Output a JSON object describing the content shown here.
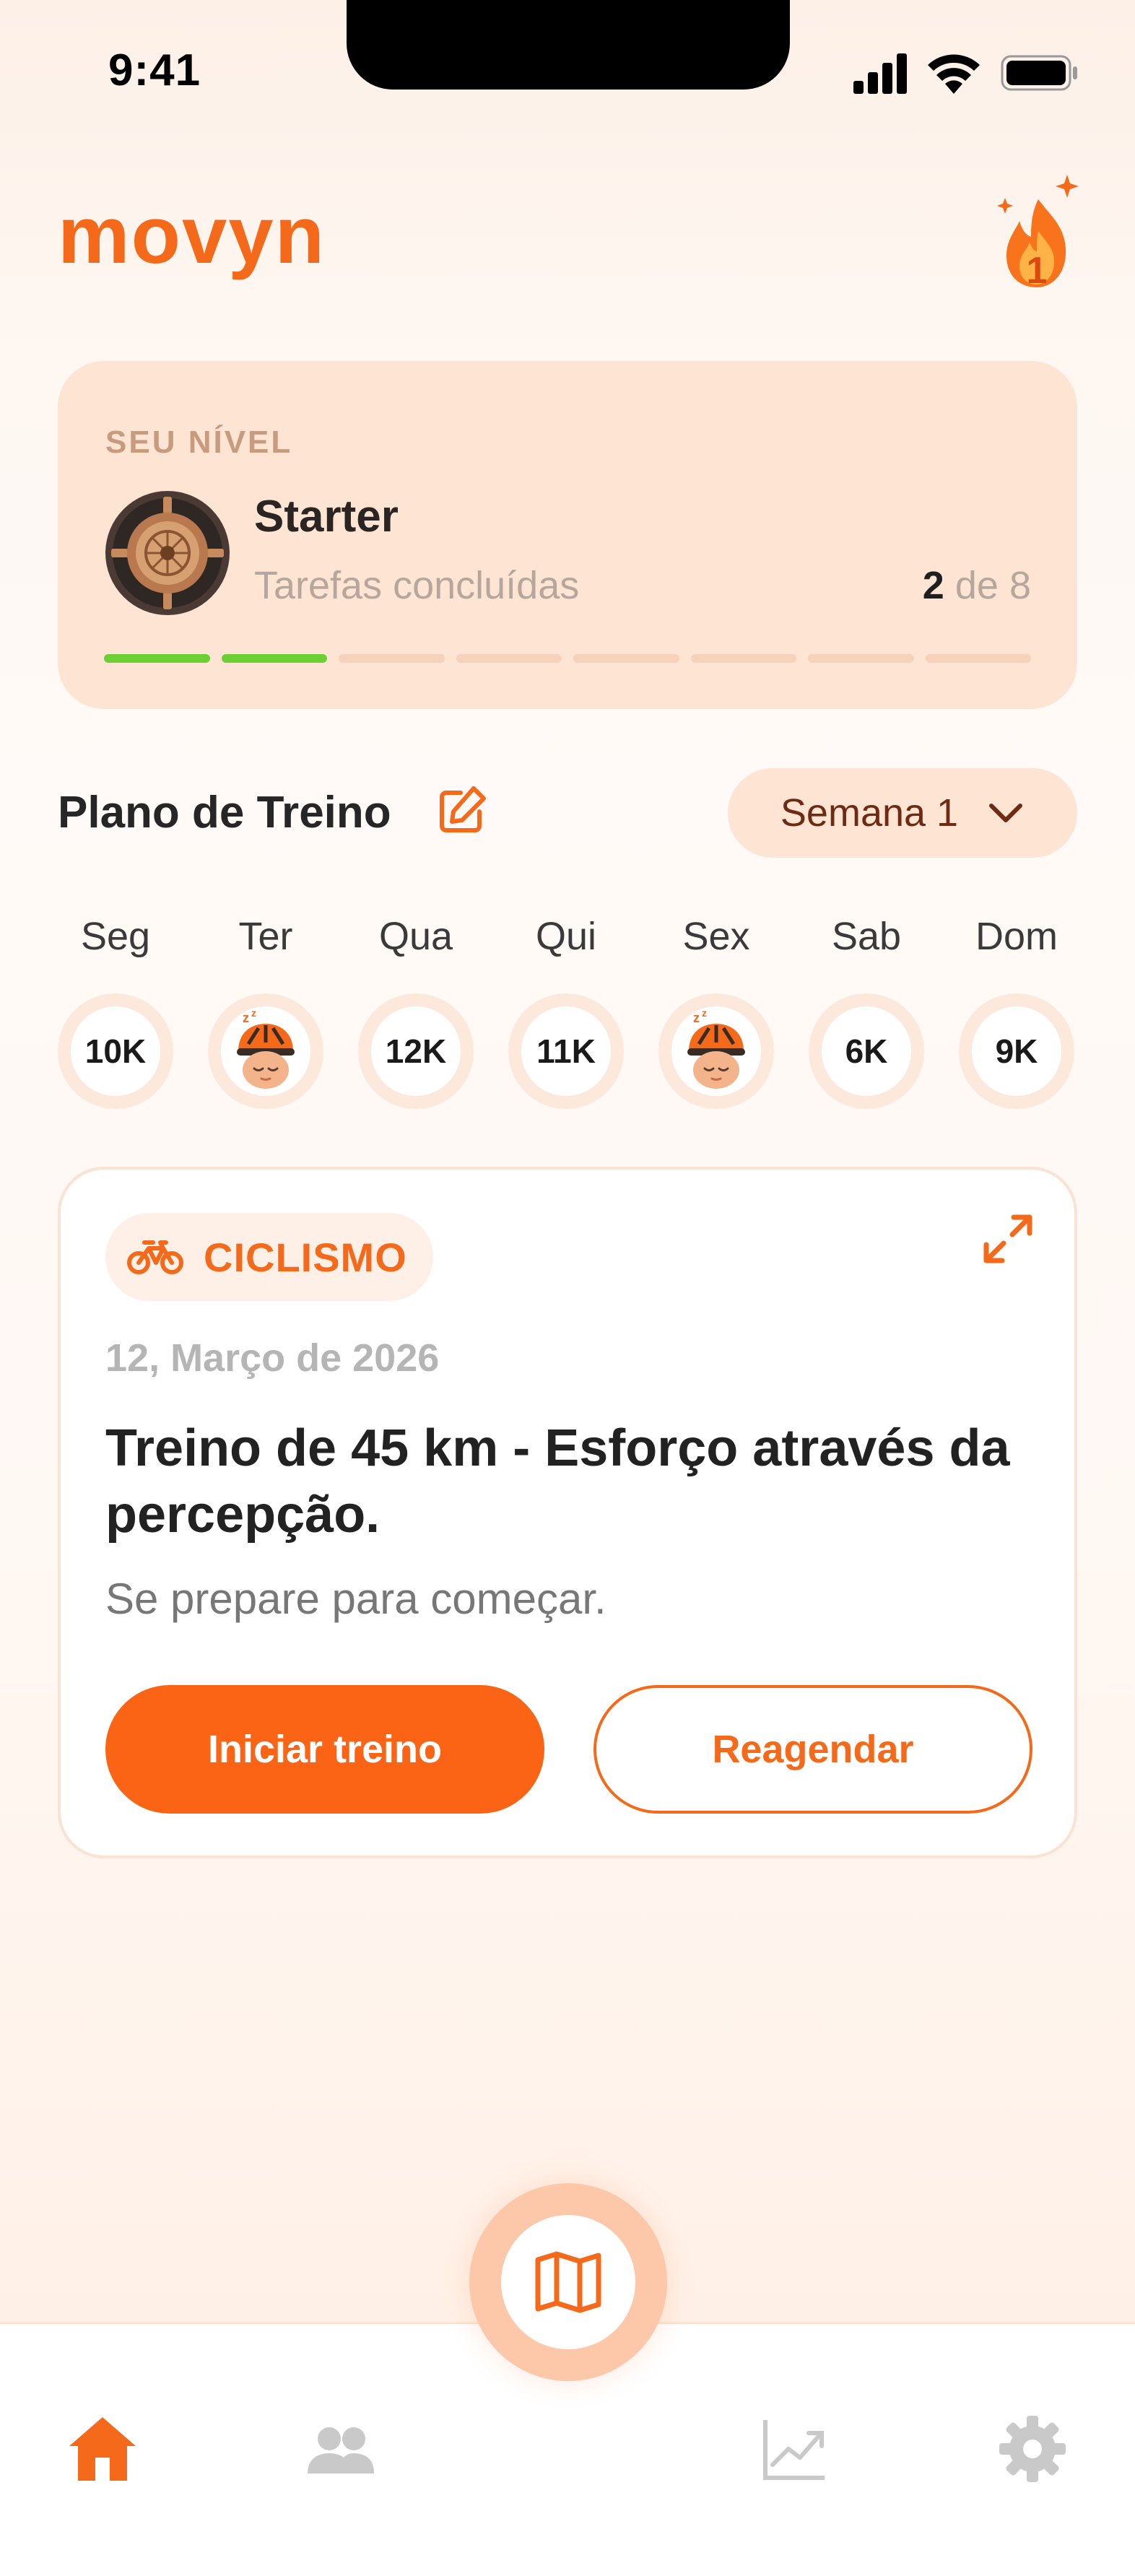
{
  "status_bar": {
    "time": "9:41"
  },
  "header": {
    "logo": "movyn",
    "streak_icon": "flame-icon",
    "streak_count": "1"
  },
  "level": {
    "kicker": "SEU NÍVEL",
    "name": "Starter",
    "tasks_label": "Tarefas concluídas",
    "completed": "2",
    "of_word": "de",
    "total": "8",
    "progress_fraction": 0.25
  },
  "plan": {
    "title": "Plano de Treino",
    "week_selector": "Semana 1",
    "days": [
      {
        "label": "Seg",
        "value": "10K",
        "rest": false
      },
      {
        "label": "Ter",
        "value": "",
        "rest": true
      },
      {
        "label": "Qua",
        "value": "12K",
        "rest": false
      },
      {
        "label": "Qui",
        "value": "11K",
        "rest": false
      },
      {
        "label": "Sex",
        "value": "",
        "rest": true
      },
      {
        "label": "Sab",
        "value": "6K",
        "rest": false
      },
      {
        "label": "Dom",
        "value": "9K",
        "rest": false
      }
    ]
  },
  "workout": {
    "sport": "CICLISMO",
    "date": "12, Março de 2026",
    "title": "Treino de 45 km - Esforço através da percepção.",
    "subtitle": "Se prepare para começar.",
    "primary_button": "Iniciar treino",
    "secondary_button": "Reagendar"
  },
  "nav": {
    "items": [
      "home-icon",
      "users-icon",
      "map-icon",
      "chart-icon",
      "gear-icon"
    ],
    "active": "home-icon"
  },
  "colors": {
    "brand": "#f56a1a",
    "progress_done": "#6ccf34",
    "card_bg": "#fde4d3"
  }
}
